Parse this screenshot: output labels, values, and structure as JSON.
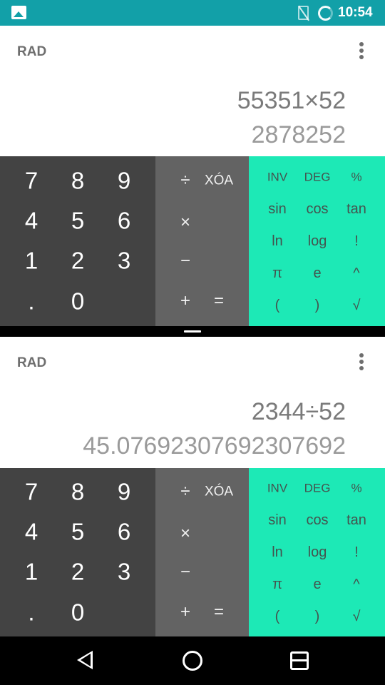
{
  "status_bar": {
    "time": "10:54",
    "icons": [
      "gallery-icon",
      "no-sim-icon",
      "sync-ring-icon"
    ]
  },
  "calculators": [
    {
      "mode": "RAD",
      "expression": "55351×52",
      "result": "2878252",
      "keys": {
        "digits": [
          "7",
          "8",
          "9",
          "4",
          "5",
          "6",
          "1",
          "2",
          "3",
          ".",
          "0"
        ],
        "ops": {
          "divide": "÷",
          "clear": "XÓA",
          "multiply": "×",
          "subtract": "−",
          "add": "+",
          "equals": "="
        },
        "advanced": [
          "INV",
          "DEG",
          "%",
          "sin",
          "cos",
          "tan",
          "ln",
          "log",
          "!",
          "π",
          "e",
          "^",
          "(",
          ")",
          "√"
        ]
      }
    },
    {
      "mode": "RAD",
      "expression": "2344÷52",
      "result": "45.0769230769230769 2",
      "keys": {
        "digits": [
          "7",
          "8",
          "9",
          "4",
          "5",
          "6",
          "1",
          "2",
          "3",
          ".",
          "0"
        ],
        "ops": {
          "divide": "÷",
          "clear": "XÓA",
          "multiply": "×",
          "subtract": "−",
          "add": "+",
          "equals": "="
        },
        "advanced": [
          "INV",
          "DEG",
          "%",
          "sin",
          "cos",
          "tan",
          "ln",
          "log",
          "!",
          "π",
          "e",
          "^",
          "(",
          ")",
          "√"
        ]
      }
    }
  ],
  "colors": {
    "status_bar": "#12a0a8",
    "numpad": "#434343",
    "operators": "#636363",
    "advanced": "#1de9b6"
  },
  "nav_bar": {
    "icons": [
      "back-icon",
      "home-icon",
      "recents-icon"
    ]
  }
}
